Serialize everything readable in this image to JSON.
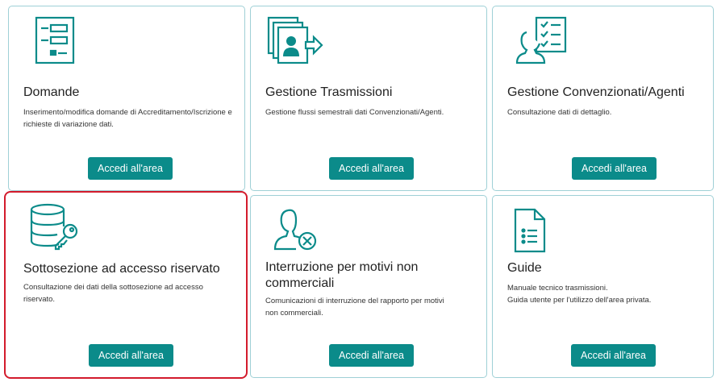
{
  "cards": [
    {
      "title": "Domande",
      "description": "Inserimento/modifica domande di Accreditamento/Iscrizione e richieste di variazione dati.",
      "button_label": "Accedi all'area",
      "icon": "form-icon"
    },
    {
      "title": "Gestione Trasmissioni",
      "description": "Gestione flussi semestrali dati Convenzionati/Agenti.",
      "button_label": "Accedi all'area",
      "icon": "transmission-icon"
    },
    {
      "title": "Gestione Convenzionati/Agenti",
      "description": "Consultazione dati di dettaglio.",
      "button_label": "Accedi all'area",
      "icon": "user-checklist-icon"
    },
    {
      "title": "Sottosezione ad accesso riservato",
      "description": "Consultazione dei dati della sottosezione ad accesso riservato.",
      "button_label": "Accedi all'area",
      "icon": "database-key-icon"
    },
    {
      "title": "Interruzione per motivi non commerciali",
      "description": "Comunicazioni di interruzione del rapporto per motivi non commerciali.",
      "button_label": "Accedi all'area",
      "icon": "user-remove-icon"
    },
    {
      "title": "Guide",
      "description_lines": [
        "Manuale tecnico trasmissioni.",
        "Guida utente per l'utilizzo dell'area privata."
      ],
      "button_label": "Accedi all'area",
      "icon": "document-list-icon"
    }
  ],
  "colors": {
    "accent": "#0b8b8a",
    "card_border": "#9fd0d6",
    "highlight_border": "#d31b2c"
  }
}
